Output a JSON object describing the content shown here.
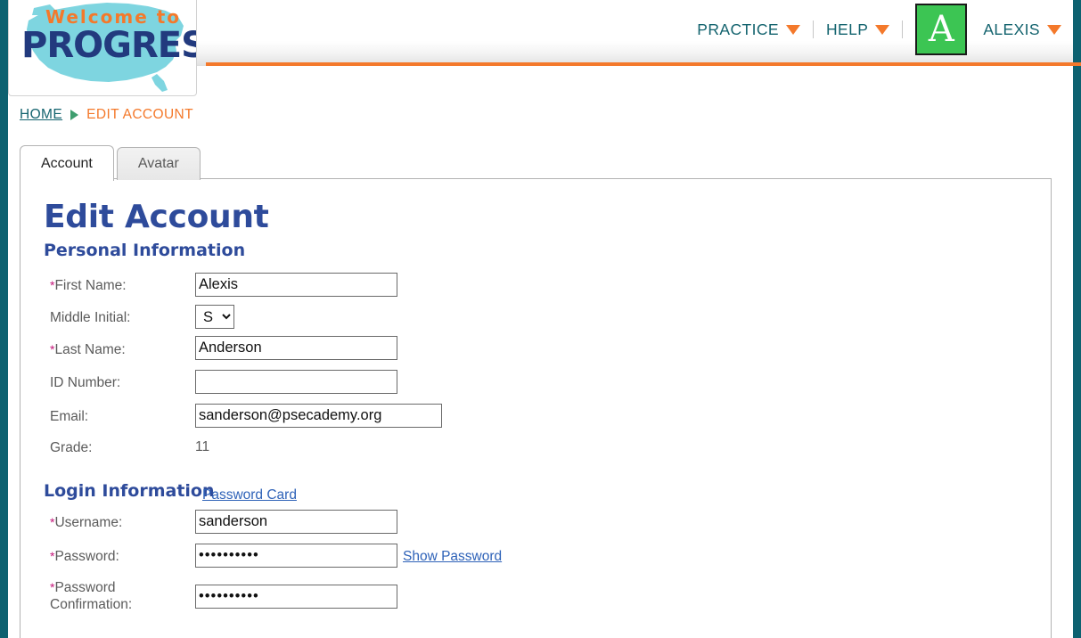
{
  "colors": {
    "rail_teal": "#0d6170",
    "accent_orange": "#f4792b",
    "nav_teal": "#13636e",
    "heading_navy": "#2e4b9b",
    "required_magenta": "#c4187a",
    "link_blue": "#2e62b8",
    "avatar_green": "#3cc553"
  },
  "logo": {
    "welcome_text": "Welcome to",
    "brand_text": "PROGRESS"
  },
  "topnav": {
    "items": [
      {
        "label": "PRACTICE",
        "icon": "chevron-down-icon"
      },
      {
        "label": "HELP",
        "icon": "chevron-down-icon"
      },
      {
        "label": "ALEXIS",
        "icon": "chevron-down-icon"
      }
    ],
    "avatar_letter": "A"
  },
  "breadcrumb": {
    "home_label": "HOME",
    "separator_icon": "triangle-right-icon",
    "current_label": "EDIT ACCOUNT"
  },
  "tabs": [
    {
      "label": "Account",
      "active": true
    },
    {
      "label": "Avatar",
      "active": false
    }
  ],
  "page": {
    "title": "Edit Account"
  },
  "personal_information": {
    "heading": "Personal Information",
    "fields": [
      {
        "label": "First Name:",
        "required": true,
        "type": "text",
        "value": "Alexis"
      },
      {
        "label": "Middle Initial:",
        "required": false,
        "type": "select",
        "value": "S"
      },
      {
        "label": "Last Name:",
        "required": true,
        "type": "text",
        "value": "Anderson"
      },
      {
        "label": "ID Number:",
        "required": false,
        "type": "text",
        "value": ""
      },
      {
        "label": "Email:",
        "required": false,
        "type": "text",
        "value": "sanderson@psecademy.org"
      },
      {
        "label": "Grade:",
        "required": false,
        "type": "static",
        "value": "11"
      }
    ]
  },
  "login_information": {
    "heading": "Login Information",
    "card_link": "Password Card",
    "show_password_link": "Show Password",
    "fields": [
      {
        "label": "Username:",
        "required": true,
        "type": "text",
        "value": "sanderson"
      },
      {
        "label": "Password:",
        "required": true,
        "type": "password",
        "value": "••••••••••"
      },
      {
        "label_line1": "Password",
        "label_line2": "Confirmation:",
        "required": true,
        "type": "password",
        "value": "••••••••••"
      }
    ]
  }
}
